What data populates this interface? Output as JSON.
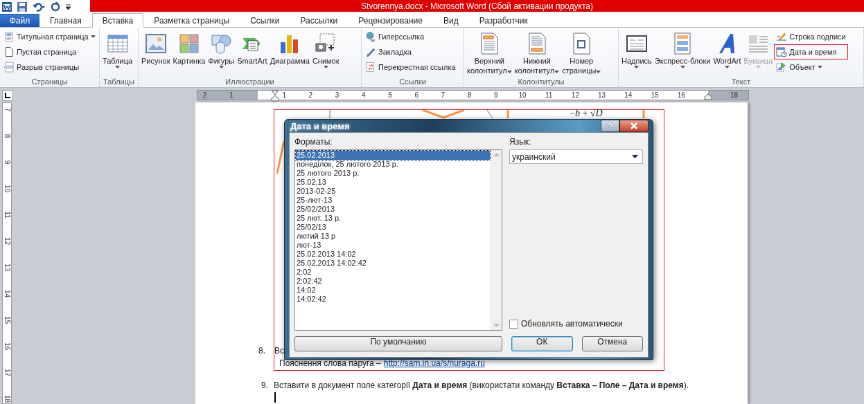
{
  "window": {
    "title": "Stvorennya.docx - Microsoft Word (Сбой активации продукта)"
  },
  "ribbon_tabs": [
    {
      "label": "Файл",
      "kind": "file",
      "selected": false
    },
    {
      "label": "Главная",
      "kind": "tab",
      "selected": false
    },
    {
      "label": "Вставка",
      "kind": "tab",
      "selected": true
    },
    {
      "label": "Разметка страницы",
      "kind": "tab",
      "selected": false
    },
    {
      "label": "Ссылки",
      "kind": "tab",
      "selected": false
    },
    {
      "label": "Рассылки",
      "kind": "tab",
      "selected": false
    },
    {
      "label": "Рецензирование",
      "kind": "tab",
      "selected": false
    },
    {
      "label": "Вид",
      "kind": "tab",
      "selected": false
    },
    {
      "label": "Разработчик",
      "kind": "tab",
      "selected": false
    }
  ],
  "ribbon_groups": [
    {
      "label": "Страницы",
      "items": [
        {
          "label": "Титульная страница",
          "kind": "small",
          "dropdown": true,
          "disabled": false,
          "highlighted": false
        },
        {
          "label": "Пустая страница",
          "kind": "small",
          "dropdown": false,
          "disabled": false,
          "highlighted": false
        },
        {
          "label": "Разрыв страницы",
          "kind": "small",
          "dropdown": false,
          "disabled": false,
          "highlighted": false
        }
      ]
    },
    {
      "label": "Таблицы",
      "items": [
        {
          "label": "Таблица",
          "kind": "large",
          "dropdown": true,
          "disabled": false,
          "highlighted": false
        }
      ]
    },
    {
      "label": "Иллюстрации",
      "items": [
        {
          "label": "Рисунок",
          "kind": "large",
          "dropdown": false,
          "disabled": false,
          "highlighted": false
        },
        {
          "label": "Картинка",
          "kind": "large",
          "dropdown": false,
          "disabled": false,
          "highlighted": false
        },
        {
          "label": "Фигуры",
          "kind": "large",
          "dropdown": true,
          "disabled": false,
          "highlighted": false
        },
        {
          "label": "SmartArt",
          "kind": "large",
          "dropdown": false,
          "disabled": false,
          "highlighted": false
        },
        {
          "label": "Диаграмма",
          "kind": "large",
          "dropdown": false,
          "disabled": false,
          "highlighted": false
        },
        {
          "label": "Снимок",
          "kind": "large",
          "dropdown": true,
          "disabled": false,
          "highlighted": false
        }
      ]
    },
    {
      "label": "Ссылки",
      "items": [
        {
          "label": "Гиперссылка",
          "kind": "small",
          "dropdown": false,
          "disabled": false,
          "highlighted": false
        },
        {
          "label": "Закладка",
          "kind": "small",
          "dropdown": false,
          "disabled": false,
          "highlighted": false
        },
        {
          "label": "Перекрестная ссылка",
          "kind": "small",
          "dropdown": false,
          "disabled": false,
          "highlighted": false
        }
      ]
    },
    {
      "label": "Колонтитулы",
      "items": [
        {
          "label": "Верхний\nколонтитул",
          "kind": "large",
          "dropdown": true,
          "disabled": false,
          "highlighted": false
        },
        {
          "label": "Нижний\nколонтитул",
          "kind": "large",
          "dropdown": true,
          "disabled": false,
          "highlighted": false
        },
        {
          "label": "Номер\nстраницы",
          "kind": "large",
          "dropdown": true,
          "disabled": false,
          "highlighted": false
        }
      ]
    },
    {
      "label": "Текст",
      "items": [
        {
          "label": "Надпись",
          "kind": "large",
          "dropdown": true,
          "disabled": false,
          "highlighted": false
        },
        {
          "label": "Экспресс-блоки",
          "kind": "large",
          "dropdown": true,
          "disabled": false,
          "highlighted": false
        },
        {
          "label": "WordArt",
          "kind": "large",
          "dropdown": true,
          "disabled": false,
          "highlighted": false
        },
        {
          "label": "Буквица",
          "kind": "large",
          "dropdown": true,
          "disabled": true,
          "highlighted": false
        },
        {
          "label": "Строка подписи",
          "kind": "small",
          "dropdown": false,
          "disabled": false,
          "highlighted": false
        },
        {
          "label": "Дата и время",
          "kind": "small",
          "dropdown": false,
          "disabled": false,
          "highlighted": true
        },
        {
          "label": "Объект",
          "kind": "small",
          "dropdown": true,
          "disabled": false,
          "highlighted": false
        }
      ]
    }
  ],
  "horizontal_ruler": [
    "2",
    "1",
    "1",
    "2",
    "3",
    "4",
    "5",
    "6",
    "7",
    "8",
    "9",
    "10",
    "11",
    "12",
    "13",
    "14",
    "15",
    "16",
    "18"
  ],
  "vertical_ruler": [
    "7",
    "8",
    "9",
    "10",
    "11",
    "12",
    "13",
    "14",
    "15",
    "16",
    "17",
    "18"
  ],
  "document": {
    "formula": "−*b* + √*D*",
    "item_8": {
      "number": "8.",
      "text": "Вс",
      "note": "Пояснення слова паруга –",
      "link": "http://sam.in.ua/s/nuraga.ru"
    },
    "item_9": {
      "number": "9.",
      "text": "Вставити в документ поле категорії **Дата и время** (використати   команду **Вставка  – Поле – Дата и время**)."
    }
  },
  "dialog": {
    "title": "Дата и время",
    "help_button": "?",
    "formats_label": "Форматы:",
    "formats": [
      {
        "text": "25.02.2013",
        "selected": true
      },
      {
        "text": "понеділок, 25 лютого 2013 р.",
        "selected": false
      },
      {
        "text": "25 лютого 2013 р.",
        "selected": false
      },
      {
        "text": "25.02.13",
        "selected": false
      },
      {
        "text": "2013-02-25",
        "selected": false
      },
      {
        "text": "25-лют-13",
        "selected": false
      },
      {
        "text": "25/02/2013",
        "selected": false
      },
      {
        "text": "25 лют. 13 р.",
        "selected": false
      },
      {
        "text": "25/02/13",
        "selected": false
      },
      {
        "text": "лютий 13 р",
        "selected": false
      },
      {
        "text": "лют-13",
        "selected": false
      },
      {
        "text": "25.02.2013 14:02",
        "selected": false
      },
      {
        "text": "25.02.2013 14:02:42",
        "selected": false
      },
      {
        "text": "2:02",
        "selected": false
      },
      {
        "text": "2:02:42",
        "selected": false
      },
      {
        "text": "14:02",
        "selected": false
      },
      {
        "text": "14:02:42",
        "selected": false
      }
    ],
    "language_label": "Язык:",
    "language": "украинский",
    "auto_update": {
      "label": "Обновлять автоматически",
      "checked": false
    },
    "buttons": [
      {
        "label": "По умолчанию",
        "kind": "left",
        "default": false
      },
      {
        "label": "ОК",
        "kind": "right",
        "default": true
      },
      {
        "label": "Отмена",
        "kind": "right",
        "default": false
      }
    ]
  }
}
